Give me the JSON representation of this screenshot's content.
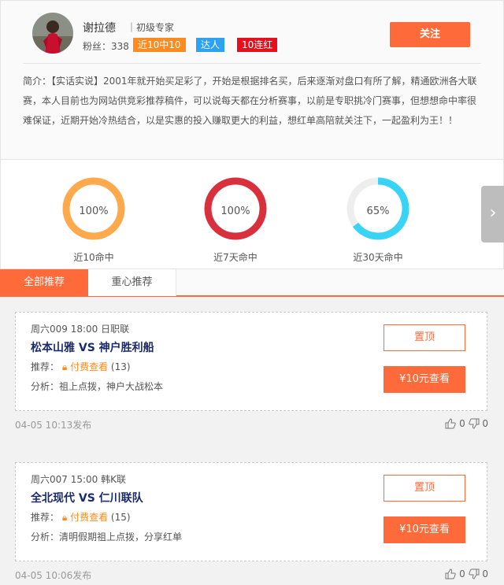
{
  "profile": {
    "name": "谢拉德",
    "level": "｜初级专家",
    "fans_label": "粉丝：338",
    "badges": [
      "近10中10",
      "达人",
      "10连红"
    ],
    "follow_label": "关注",
    "intro": "简介：【实话实说】2001年就开始买足彩了，开始是根据排名买，后来逐渐对盘口有所了解，精通欧洲各大联赛，本人目前也为网站供竞彩推荐稿件，可以说每天都在分析赛事，以前是专职挑冷门赛事，但想想命中率很难保证，近期开始冷热结合，以是实惠的投入赚取更大的利益，想红单高陪就关注下，一起盈利为王！！"
  },
  "stats": [
    {
      "pct_label": "100%",
      "value": 100,
      "label": "近10命中",
      "color": "#ffa94d"
    },
    {
      "pct_label": "100%",
      "value": 100,
      "label": "近7天命中",
      "color": "#d9303e"
    },
    {
      "pct_label": "65%",
      "value": 65,
      "label": "近30天命中",
      "color": "#39d3f5"
    }
  ],
  "tabs": [
    "全部推荐",
    "重心推荐"
  ],
  "cards": [
    {
      "meta": "周六009 18:00 日职联",
      "teams": "松本山雅 VS 神户胜利船",
      "rec_prefix": "推荐：",
      "paid_label": "付费查看",
      "count": "(13)",
      "analysis": "分析：祖上点拨，神户大战松本",
      "top_btn": "置顶",
      "buy_btn": "¥10元查看",
      "time": "04-05 10:13发布",
      "likes": "0",
      "dislikes": "0"
    },
    {
      "meta": "周六007 15:00 韩K联",
      "teams": "全北现代 VS 仁川联队",
      "rec_prefix": "推荐：",
      "paid_label": "付费查看",
      "count": "(15)",
      "analysis": "分析：清明假期祖上点拨，分享红单",
      "top_btn": "置顶",
      "buy_btn": "¥10元查看",
      "time": "04-05 10:06发布",
      "likes": "0",
      "dislikes": "0"
    }
  ],
  "icons": {
    "next": "chevron-right-icon",
    "lock": "lock-icon",
    "like": "thumb-up-icon",
    "dislike": "thumb-down-icon"
  }
}
